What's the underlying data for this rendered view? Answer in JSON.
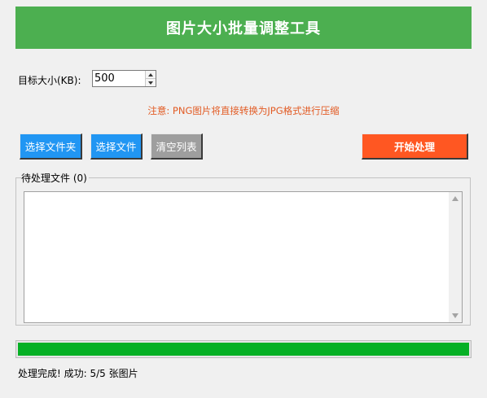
{
  "app": {
    "title": "图片大小批量调整工具"
  },
  "settings": {
    "target_size_label": "目标大小(KB):",
    "target_size_value": "500"
  },
  "note": "注意: PNG图片将直接转换为JPG格式进行压缩",
  "toolbar": {
    "select_folder": "选择文件夹",
    "select_files": "选择文件",
    "clear_list": "清空列表",
    "start": "开始处理"
  },
  "file_list": {
    "legend": "待处理文件 (0)",
    "items": []
  },
  "progress": {
    "value": 1.0
  },
  "status": "处理完成! 成功: 5/5 张图片",
  "colors": {
    "header": "#4caf50",
    "button_blue": "#2196f3",
    "button_gray": "#9e9e9e",
    "button_start": "#ff5722",
    "note_text": "#e25b24",
    "progress_fill": "#06b025"
  }
}
